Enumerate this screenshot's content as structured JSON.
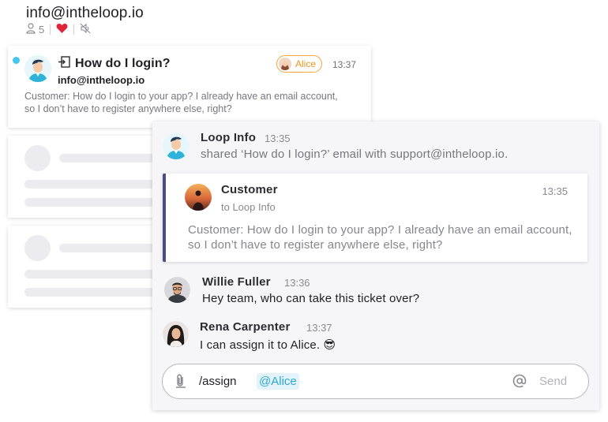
{
  "header": {
    "title": "info@intheloop.io",
    "participants_count": "5"
  },
  "conversation_card": {
    "subject": "How do I login?",
    "sender": "info@intheloop.io",
    "preview": "Customer: How do I login to your app? I already have an email account, so I don’t have to register anywhere else, right?",
    "assignee": "Alice",
    "time": "13:37"
  },
  "chat": {
    "system_message": {
      "name": "Loop Info",
      "time": "13:35",
      "text": "shared ‘How do I login?’ email with support@intheloop.io."
    },
    "shared_email": {
      "name": "Customer",
      "to": "to Loop Info",
      "time": "13:35",
      "body": "Customer: How do I login to your app? I already have an email account, so I don’t have to register anywhere else, right?"
    },
    "messages": [
      {
        "name": "Willie Fuller",
        "time": "13:36",
        "text": "Hey team, who can take this ticket over?"
      },
      {
        "name": "Rena Carpenter",
        "time": "13:37",
        "text": "I can assign it to Alice. 😎"
      }
    ]
  },
  "composer": {
    "command": "/assign",
    "mention": "@Alice",
    "send_label": "Send"
  },
  "colors": {
    "unread": "#44c6ee",
    "assignee_accent": "#f0951c",
    "heart": "#e0243a",
    "quote_border": "#4c4c86",
    "mention": "#2fa6d6"
  },
  "icons": [
    "user-icon",
    "heart-icon",
    "mute-icon",
    "email-share-icon",
    "paperclip-icon",
    "at-icon"
  ]
}
